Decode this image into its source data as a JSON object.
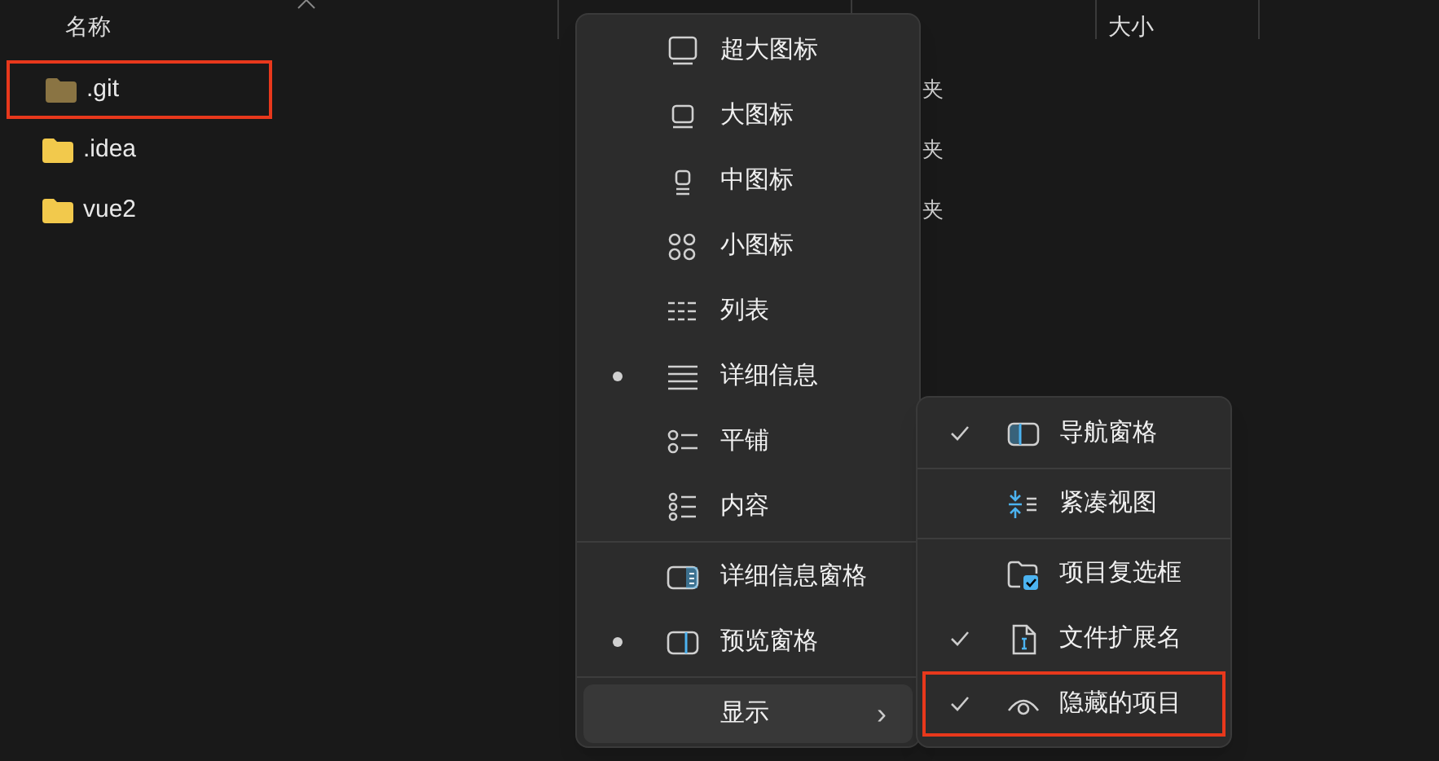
{
  "file_list": {
    "columns": [
      {
        "label": "名称"
      },
      {
        "label": "大小"
      }
    ],
    "rows": [
      {
        "name": ".git",
        "type_fragment": "夹",
        "hidden": true,
        "highlighted": true
      },
      {
        "name": ".idea",
        "type_fragment": "夹",
        "hidden": false,
        "highlighted": false
      },
      {
        "name": "vue2",
        "type_fragment": "夹",
        "hidden": false,
        "highlighted": false
      }
    ]
  },
  "view_menu": {
    "items": [
      {
        "kind": "item",
        "label": "超大图标",
        "selected": false
      },
      {
        "kind": "item",
        "label": "大图标",
        "selected": false
      },
      {
        "kind": "item",
        "label": "中图标",
        "selected": false
      },
      {
        "kind": "item",
        "label": "小图标",
        "selected": false
      },
      {
        "kind": "item",
        "label": "列表",
        "selected": false
      },
      {
        "kind": "item",
        "label": "详细信息",
        "selected": true
      },
      {
        "kind": "item",
        "label": "平铺",
        "selected": false
      },
      {
        "kind": "item",
        "label": "内容",
        "selected": false
      },
      {
        "kind": "divider"
      },
      {
        "kind": "item",
        "label": "详细信息窗格",
        "selected": false
      },
      {
        "kind": "item",
        "label": "预览窗格",
        "selected": true
      },
      {
        "kind": "divider"
      },
      {
        "kind": "submenu",
        "label": "显示",
        "glyph": "›",
        "expanded": true
      }
    ]
  },
  "show_submenu": {
    "items": [
      {
        "kind": "item",
        "label": "导航窗格",
        "checked": true,
        "highlighted": false
      },
      {
        "kind": "divider"
      },
      {
        "kind": "item",
        "label": "紧凑视图",
        "checked": false,
        "highlighted": false
      },
      {
        "kind": "divider"
      },
      {
        "kind": "item",
        "label": "项目复选框",
        "checked": false,
        "highlighted": false
      },
      {
        "kind": "item",
        "label": "文件扩展名",
        "checked": true,
        "highlighted": false
      },
      {
        "kind": "item",
        "label": "隐藏的项目",
        "checked": true,
        "highlighted": true
      }
    ]
  }
}
